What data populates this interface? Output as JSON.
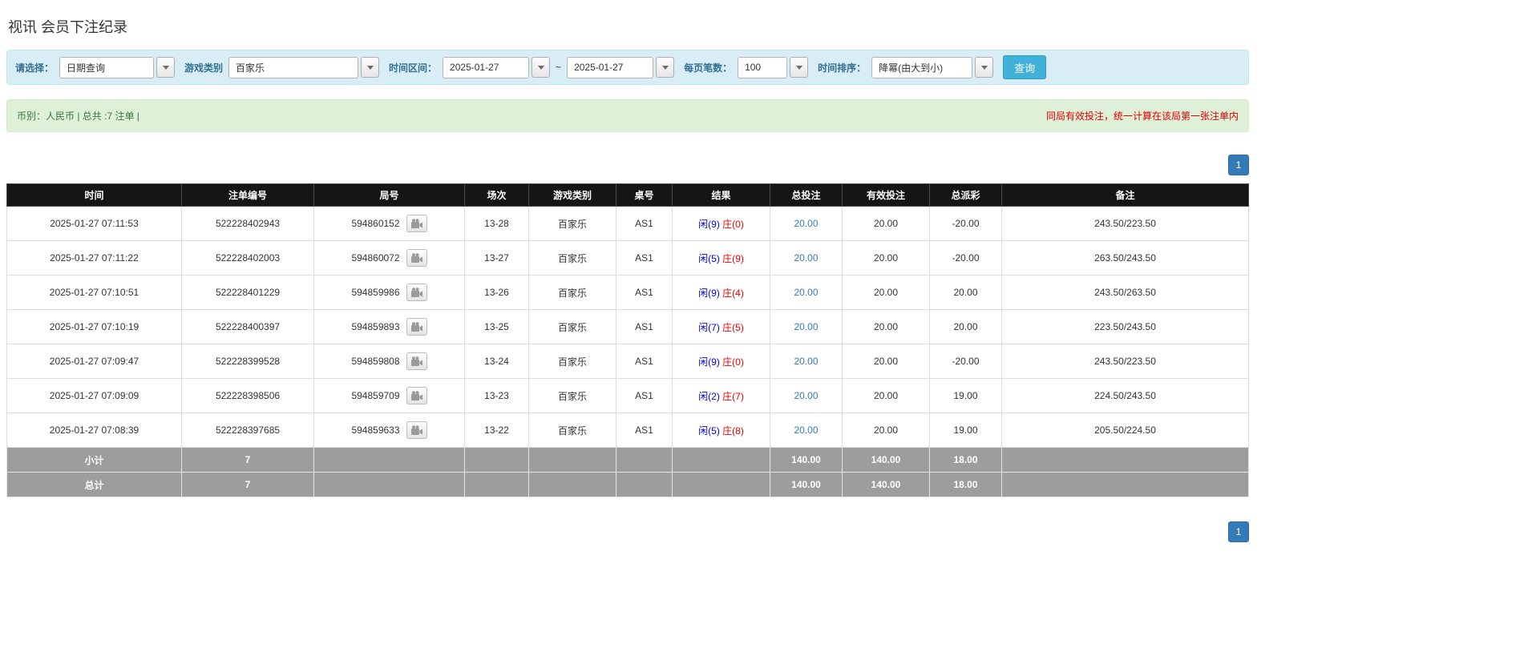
{
  "page": {
    "title": "视讯 会员下注纪录"
  },
  "filters": {
    "select_label": "请选择：",
    "select_value": "日期查询",
    "game_type_label": "游戏类别",
    "game_type_value": "百家乐",
    "date_range_label": "时间区间：",
    "date_from": "2025-01-27",
    "date_separator": "~",
    "date_to": "2025-01-27",
    "page_size_label": "每页笔数：",
    "page_size_value": "100",
    "sort_label": "时间排序：",
    "sort_value": "降幂(由大到小)",
    "search_button": "查询"
  },
  "summary": {
    "left": "币别：人民币 | 总共 :7 注单 |",
    "right": "同局有效投注，统一计算在该局第一张注单内"
  },
  "pagination": {
    "page": "1"
  },
  "icons": {
    "chevron_down": "▼",
    "video_camera": "video-camera"
  },
  "table": {
    "headers": [
      "时间",
      "注单编号",
      "局号",
      "场次",
      "游戏类别",
      "桌号",
      "结果",
      "总投注",
      "有效投注",
      "总派彩",
      "备注"
    ],
    "rows": [
      {
        "time": "2025-01-27 07:11:53",
        "bet_id": "522228402943",
        "round_id": "594860152",
        "session": "13-28",
        "game": "百家乐",
        "table_no": "AS1",
        "result_player": "闲(9)",
        "result_banker": "庄(0)",
        "total_bet": "20.00",
        "valid_bet": "20.00",
        "payout": "-20.00",
        "remark": "243.50/223.50"
      },
      {
        "time": "2025-01-27 07:11:22",
        "bet_id": "522228402003",
        "round_id": "594860072",
        "session": "13-27",
        "game": "百家乐",
        "table_no": "AS1",
        "result_player": "闲(5)",
        "result_banker": "庄(9)",
        "total_bet": "20.00",
        "valid_bet": "20.00",
        "payout": "-20.00",
        "remark": "263.50/243.50"
      },
      {
        "time": "2025-01-27 07:10:51",
        "bet_id": "522228401229",
        "round_id": "594859986",
        "session": "13-26",
        "game": "百家乐",
        "table_no": "AS1",
        "result_player": "闲(9)",
        "result_banker": "庄(4)",
        "total_bet": "20.00",
        "valid_bet": "20.00",
        "payout": "20.00",
        "remark": "243.50/263.50"
      },
      {
        "time": "2025-01-27 07:10:19",
        "bet_id": "522228400397",
        "round_id": "594859893",
        "session": "13-25",
        "game": "百家乐",
        "table_no": "AS1",
        "result_player": "闲(7)",
        "result_banker": "庄(5)",
        "total_bet": "20.00",
        "valid_bet": "20.00",
        "payout": "20.00",
        "remark": "223.50/243.50"
      },
      {
        "time": "2025-01-27 07:09:47",
        "bet_id": "522228399528",
        "round_id": "594859808",
        "session": "13-24",
        "game": "百家乐",
        "table_no": "AS1",
        "result_player": "闲(9)",
        "result_banker": "庄(0)",
        "total_bet": "20.00",
        "valid_bet": "20.00",
        "payout": "-20.00",
        "remark": "243.50/223.50"
      },
      {
        "time": "2025-01-27 07:09:09",
        "bet_id": "522228398506",
        "round_id": "594859709",
        "session": "13-23",
        "game": "百家乐",
        "table_no": "AS1",
        "result_player": "闲(2)",
        "result_banker": "庄(7)",
        "total_bet": "20.00",
        "valid_bet": "20.00",
        "payout": "19.00",
        "remark": "224.50/243.50"
      },
      {
        "time": "2025-01-27 07:08:39",
        "bet_id": "522228397685",
        "round_id": "594859633",
        "session": "13-22",
        "game": "百家乐",
        "table_no": "AS1",
        "result_player": "闲(5)",
        "result_banker": "庄(8)",
        "total_bet": "20.00",
        "valid_bet": "20.00",
        "payout": "19.00",
        "remark": "205.50/224.50"
      }
    ],
    "subtotal": {
      "label": "小计",
      "count": "7",
      "total_bet": "140.00",
      "valid_bet": "140.00",
      "payout": "18.00"
    },
    "total": {
      "label": "总计",
      "count": "7",
      "total_bet": "140.00",
      "valid_bet": "140.00",
      "payout": "18.00"
    }
  }
}
